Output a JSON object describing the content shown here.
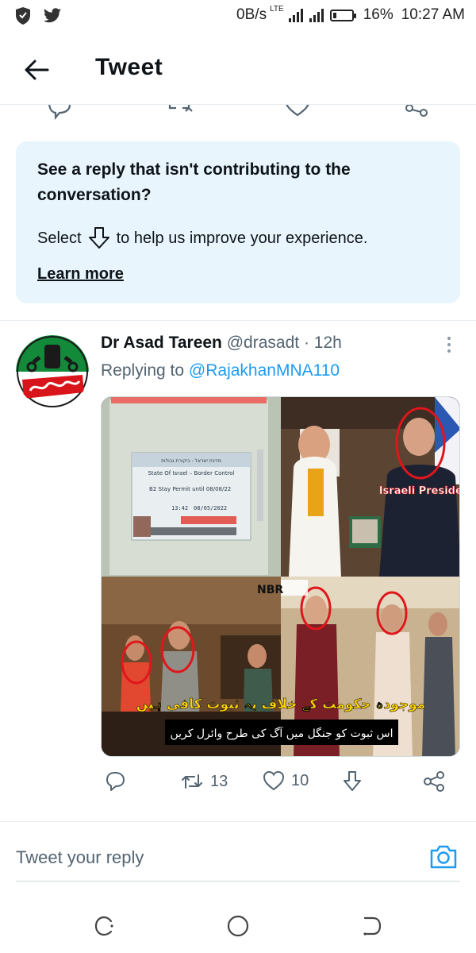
{
  "status_bar": {
    "data_rate": "0B/s",
    "network_type": "LTE",
    "battery": "16%",
    "time": "10:27 AM",
    "icons": [
      "shield-icon",
      "twitter-bird-icon",
      "signal-icon",
      "battery-icon"
    ]
  },
  "header": {
    "title": "Tweet",
    "back_icon": "arrow-left-icon"
  },
  "prev_tweet_actions": [
    "reply-icon",
    "retweet-icon",
    "like-icon",
    "share-icon"
  ],
  "info_card": {
    "title": "See a reply that isn't contributing to the conversation?",
    "body_before": "Select",
    "body_icon": "downvote-arrow-icon",
    "body_after": "to help us improve your experience.",
    "link": "Learn more",
    "background": "#e8f5fd"
  },
  "tweet": {
    "author_name": "Dr Asad Tareen",
    "handle": "@drasadt",
    "separator": "·",
    "time": "12h",
    "replying_prefix": "Replying to",
    "replying_to": "@RajakhanMNA110",
    "media": {
      "passport_title": "State Of Israel – Border Control",
      "passport_hebrew": "מדינת ישראל - ביקורת גבולות",
      "permit_text": "B2 Stay Permit until 08/08/22",
      "permit_time": "13:42",
      "permit_date": "08/05/2022",
      "president_label": "Israeli President",
      "watermark": "NBR",
      "urdu_line1": "موجودہ حکومت کے خلاف یہ ثبوت کافی ہیں",
      "urdu_line2": "اس ثبوت کو جنگل میں آگ کی طرح وائرل کریں"
    },
    "actions": {
      "reply_icon": "reply-icon",
      "retweets": "13",
      "likes": "10",
      "downvote_icon": "downvote-arrow-icon",
      "share_icon": "share-icon"
    }
  },
  "reply_box": {
    "placeholder": "Tweet your reply",
    "camera_icon": "camera-icon"
  },
  "nav_bar": [
    "recents-icon",
    "home-icon",
    "back-icon"
  ],
  "colors": {
    "accent": "#1d9bf0",
    "secondary_text": "#536471",
    "highlight_red": "#e0161b"
  }
}
